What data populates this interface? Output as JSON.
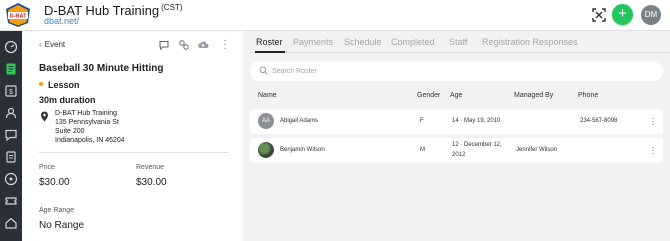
{
  "header": {
    "logo_text": "D-BAT",
    "hub_name": "D-BAT Hub Training",
    "timezone": "(CST)",
    "url": "dbat.net/",
    "add_label": "+",
    "user_initials": "DM",
    "accent_color": "#22c55e"
  },
  "nav": {
    "items": [
      {
        "icon": "dashboard-icon"
      },
      {
        "icon": "book-icon",
        "active": true
      },
      {
        "icon": "dollar-icon"
      },
      {
        "icon": "users-icon"
      },
      {
        "icon": "message-icon"
      },
      {
        "icon": "clipboard-icon"
      },
      {
        "icon": "gauge-icon"
      },
      {
        "icon": "ticket-icon"
      },
      {
        "icon": "home-icon"
      }
    ]
  },
  "event": {
    "back_label": "Event",
    "title": "Baseball 30 Minute Hitting",
    "type": "Lesson",
    "duration": "30m duration",
    "address": {
      "line1": "D-BAT Hub Training",
      "line2": "135 Pennsylvania St",
      "line3": "Suite 200",
      "line4": "Indianapolis, IN 46204"
    },
    "price_label": "Price",
    "price_value": "$30.00",
    "revenue_label": "Revenue",
    "revenue_value": "$30.00",
    "age_range_label": "Age Range",
    "age_range_value": "No Range"
  },
  "tabs": [
    "Roster",
    "Payments",
    "Schedule",
    "Completed",
    "Staff",
    "Registration Responses"
  ],
  "search": {
    "placeholder": "Search Roster"
  },
  "roster": {
    "columns": [
      "Name",
      "Gender",
      "Age",
      "Managed By",
      "Phone"
    ],
    "rows": [
      {
        "initials": "AA",
        "name": "Abigail Adams",
        "gender": "F",
        "age_line1": "14 · May 19, 2010",
        "age_line2": "",
        "managed_by": "",
        "phone": "234-567-8098"
      },
      {
        "initials": "",
        "name": "Benjamin Wilson",
        "gender": "M",
        "age_line1": "12 · December 12,",
        "age_line2": "2012",
        "managed_by": "Jennifer Wilson",
        "phone": ""
      }
    ]
  }
}
